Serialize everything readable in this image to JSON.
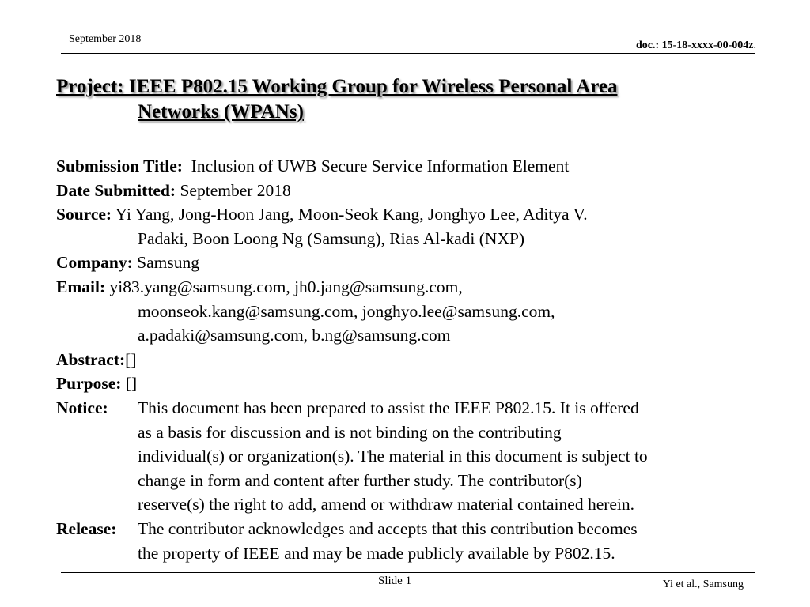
{
  "header": {
    "date": "September 2018",
    "doc_label": "doc.: 15-18-xxxx-00-004z",
    "doc_suffix": "."
  },
  "title": {
    "line1": "Project: IEEE P802.15 Working Group for Wireless Personal Area",
    "line2": "Networks (WPANs)"
  },
  "fields": {
    "submission_title_label": "Submission Title:",
    "submission_title_value": "Inclusion of UWB Secure Service Information Element",
    "date_label": "Date Submitted:",
    "date_value": "September 2018",
    "source_label": "Source:",
    "source_line1": "Yi Yang, Jong-Hoon Jang, Moon-Seok Kang, Jonghyo Lee, Aditya V.",
    "source_line2": "Padaki, Boon Loong Ng (Samsung), Rias Al-kadi (NXP)",
    "company_label": "Company:",
    "company_value": "Samsung",
    "email_label": "Email:",
    "email_line1": "yi83.yang@samsung.com, jh0.jang@samsung.com,",
    "email_line2": "moonseok.kang@samsung.com, jonghyo.lee@samsung.com,",
    "email_line3": "a.padaki@samsung.com, b.ng@samsung.com",
    "abstract_label": "Abstract:",
    "abstract_value": "[]",
    "purpose_label": "Purpose:",
    "purpose_value": "[]",
    "notice_label": "Notice:",
    "notice_lines": [
      "This document has been prepared to assist the IEEE P802.15.  It is offered",
      "as a basis for discussion and is not binding on the contributing",
      "individual(s) or organization(s). The material in this document is subject to",
      "change in form and content after further study. The contributor(s)",
      "reserve(s) the right to add, amend or withdraw material contained herein."
    ],
    "release_label": "Release:",
    "release_lines": [
      "The contributor acknowledges and accepts that this contribution becomes",
      "the property of IEEE and may be made publicly available by P802.15."
    ]
  },
  "footer": {
    "slide": "Slide 1",
    "author": "Yi et al., Samsung"
  }
}
